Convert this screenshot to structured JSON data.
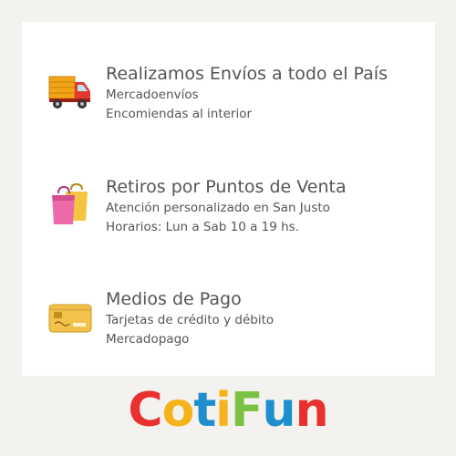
{
  "features": [
    {
      "icon": "delivery-truck-icon",
      "title": "Realizamos Envíos a todo el País",
      "lines": [
        "Mercadoenvíos",
        "Encomiendas al interior"
      ]
    },
    {
      "icon": "shopping-bags-icon",
      "title": "Retiros por Puntos de Venta",
      "lines": [
        "Atención personalizado en San Justo",
        "Horarios: Lun a Sab 10 a 19 hs."
      ]
    },
    {
      "icon": "credit-card-icon",
      "title": "Medios de Pago",
      "lines": [
        "Tarjetas de crédito y débito",
        "Mercadopago"
      ]
    }
  ],
  "brand": {
    "letters": [
      "C",
      "o",
      "t",
      "i",
      "F",
      "u",
      "n"
    ],
    "colors": [
      "#e8312f",
      "#f6b21b",
      "#1f8ecf",
      "#f6b21b",
      "#7ac143",
      "#1f8ecf",
      "#e8312f"
    ]
  }
}
